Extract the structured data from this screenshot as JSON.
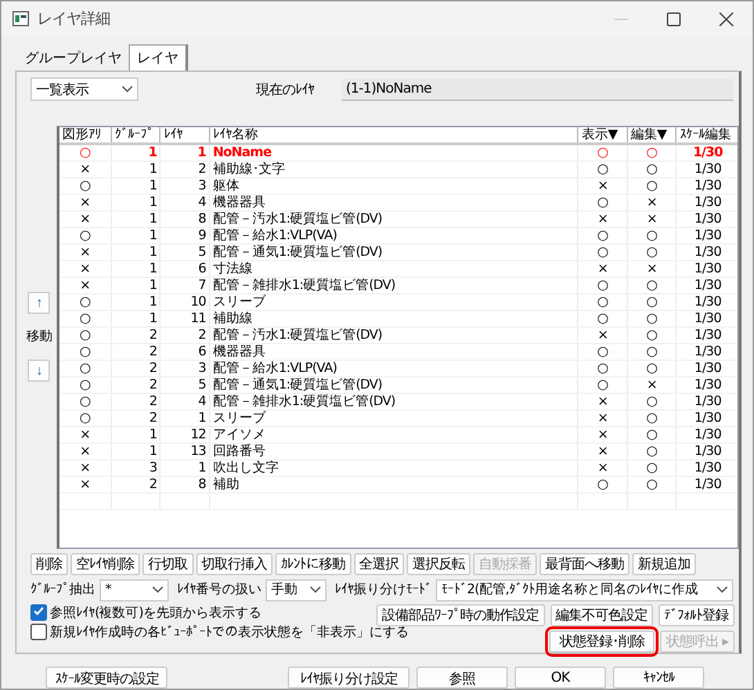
{
  "window": {
    "title": "レイヤ詳細"
  },
  "tabs": [
    {
      "label": "グループレイヤ",
      "selected": false
    },
    {
      "label": "レイヤ",
      "selected": true
    }
  ],
  "view_select": {
    "value": "一覧表示"
  },
  "current_layer": {
    "label": "現在のﾚｲﾔ",
    "value": "(1-1)NoName"
  },
  "move": {
    "up": "↑",
    "label": "移動",
    "down": "↓"
  },
  "table": {
    "columns": [
      "図形ｱﾘ",
      "ｸﾞﾙｰﾌﾟ",
      "ﾚｲﾔ",
      "ﾚｲﾔ名称",
      "表示▼",
      "編集▼",
      "ｽｹｰﾙ編集"
    ],
    "rows": [
      {
        "selected": true,
        "cells": [
          "○",
          "1",
          "1",
          "NoName",
          "○",
          "○",
          "1/30"
        ]
      },
      {
        "selected": false,
        "cells": [
          "×",
          "1",
          "2",
          "補助線･文字",
          "○",
          "○",
          "1/30"
        ]
      },
      {
        "selected": false,
        "cells": [
          "○",
          "1",
          "3",
          "躯体",
          "×",
          "○",
          "1/30"
        ]
      },
      {
        "selected": false,
        "cells": [
          "×",
          "1",
          "4",
          "機器器具",
          "○",
          "×",
          "1/30"
        ]
      },
      {
        "selected": false,
        "cells": [
          "×",
          "1",
          "8",
          "配管－汚水1:硬質塩ビ管(DV)",
          "×",
          "×",
          "1/30"
        ]
      },
      {
        "selected": false,
        "cells": [
          "○",
          "1",
          "9",
          "配管－給水1:VLP(VA)",
          "○",
          "○",
          "1/30"
        ]
      },
      {
        "selected": false,
        "cells": [
          "×",
          "1",
          "5",
          "配管－通気1:硬質塩ビ管(DV)",
          "○",
          "○",
          "1/30"
        ]
      },
      {
        "selected": false,
        "cells": [
          "×",
          "1",
          "6",
          "寸法線",
          "×",
          "×",
          "1/30"
        ]
      },
      {
        "selected": false,
        "cells": [
          "×",
          "1",
          "7",
          "配管－雑排水1:硬質塩ビ管(DV)",
          "○",
          "○",
          "1/30"
        ]
      },
      {
        "selected": false,
        "cells": [
          "○",
          "1",
          "10",
          "スリーブ",
          "○",
          "○",
          "1/30"
        ]
      },
      {
        "selected": false,
        "cells": [
          "○",
          "1",
          "11",
          "補助線",
          "○",
          "○",
          "1/30"
        ]
      },
      {
        "selected": false,
        "cells": [
          "○",
          "2",
          "2",
          "配管－汚水1:硬質塩ビ管(DV)",
          "×",
          "○",
          "1/30"
        ]
      },
      {
        "selected": false,
        "cells": [
          "○",
          "2",
          "6",
          "機器器具",
          "○",
          "○",
          "1/30"
        ]
      },
      {
        "selected": false,
        "cells": [
          "○",
          "2",
          "3",
          "配管－給水1:VLP(VA)",
          "○",
          "○",
          "1/30"
        ]
      },
      {
        "selected": false,
        "cells": [
          "○",
          "2",
          "5",
          "配管－通気1:硬質塩ビ管(DV)",
          "○",
          "×",
          "1/30"
        ]
      },
      {
        "selected": false,
        "cells": [
          "○",
          "2",
          "4",
          "配管－雑排水1:硬質塩ビ管(DV)",
          "×",
          "○",
          "1/30"
        ]
      },
      {
        "selected": false,
        "cells": [
          "○",
          "2",
          "1",
          "スリーブ",
          "×",
          "○",
          "1/30"
        ]
      },
      {
        "selected": false,
        "cells": [
          "×",
          "1",
          "12",
          "アイソメ",
          "×",
          "○",
          "1/30"
        ]
      },
      {
        "selected": false,
        "cells": [
          "×",
          "1",
          "13",
          "回路番号",
          "×",
          "○",
          "1/30"
        ]
      },
      {
        "selected": false,
        "cells": [
          "×",
          "3",
          "1",
          "吹出し文字",
          "×",
          "○",
          "1/30"
        ]
      },
      {
        "selected": false,
        "cells": [
          "×",
          "2",
          "8",
          "補助",
          "○",
          "○",
          "1/30"
        ]
      }
    ]
  },
  "action_buttons": [
    {
      "label": "削除",
      "disabled": false
    },
    {
      "label": "空ﾚｲﾔ削除",
      "disabled": false
    },
    {
      "label": "行切取",
      "disabled": false
    },
    {
      "label": "切取行挿入",
      "disabled": false
    },
    {
      "label": "ｶﾚﾝﾄに移動",
      "disabled": false
    },
    {
      "label": "全選択",
      "disabled": false
    },
    {
      "label": "選択反転",
      "disabled": false
    },
    {
      "label": "自動採番",
      "disabled": true
    },
    {
      "label": "最背面へ移動",
      "disabled": false
    },
    {
      "label": "新規追加",
      "disabled": false
    }
  ],
  "filters": [
    {
      "label": "ｸﾞﾙｰﾌﾟ抽出",
      "value": "*"
    },
    {
      "label": "ﾚｲﾔ番号の扱い",
      "value": "手動"
    },
    {
      "label": "ﾚｲﾔ振り分けﾓｰﾄﾞ",
      "value": "ﾓｰﾄﾞ2(配管,ﾀﾞｸﾄ用途名称と同名のﾚｲﾔに作成"
    }
  ],
  "checkboxes": [
    {
      "label": "参照ﾚｲﾔ(複数可)を先頭から表示する",
      "checked": true
    },
    {
      "label": "新規ﾚｲﾔ作成時の各ﾋﾞｭｰﾎﾟｰﾄでの表示状態を「非表示」にする",
      "checked": false
    }
  ],
  "setting_buttons": [
    [
      {
        "label": "設備部品ﾜｰﾌﾟ時の動作設定",
        "disabled": false,
        "highlighted": false
      },
      {
        "label": "編集不可色設定",
        "disabled": false,
        "highlighted": false
      },
      {
        "label": "ﾃﾞﾌｫﾙﾄ登録",
        "disabled": false,
        "highlighted": false
      }
    ],
    [
      {
        "label": "状態登録･削除",
        "disabled": false,
        "highlighted": true
      },
      {
        "label": "状態呼出 ▸",
        "disabled": true,
        "highlighted": false
      }
    ]
  ],
  "footer_buttons": [
    "ｽｹｰﾙ変更時の設定",
    "ﾚｲﾔ振り分け設定",
    "参照",
    "OK",
    "ｷｬﾝｾﾙ"
  ]
}
